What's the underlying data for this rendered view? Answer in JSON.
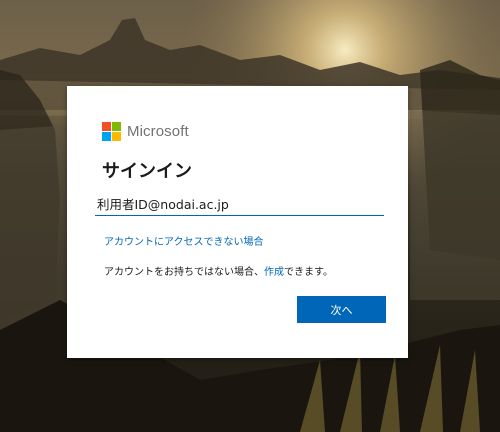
{
  "brand": {
    "name": "Microsoft",
    "logo_colors": [
      "#f25022",
      "#7fba00",
      "#00a4ef",
      "#ffb900"
    ]
  },
  "signin": {
    "title": "サインイン",
    "email_value": "利用者ID@nodai.ac.jp",
    "no_access_link": "アカウントにアクセスできない場合",
    "no_account_text": "アカウントをお持ちではない場合、",
    "create_link": "作成",
    "create_suffix": "できます。",
    "next_button": "次へ"
  },
  "colors": {
    "accent": "#0067b8",
    "text": "#1b1b1b",
    "card_bg": "#ffffff"
  },
  "background": {
    "icon": "landscape-photo"
  }
}
